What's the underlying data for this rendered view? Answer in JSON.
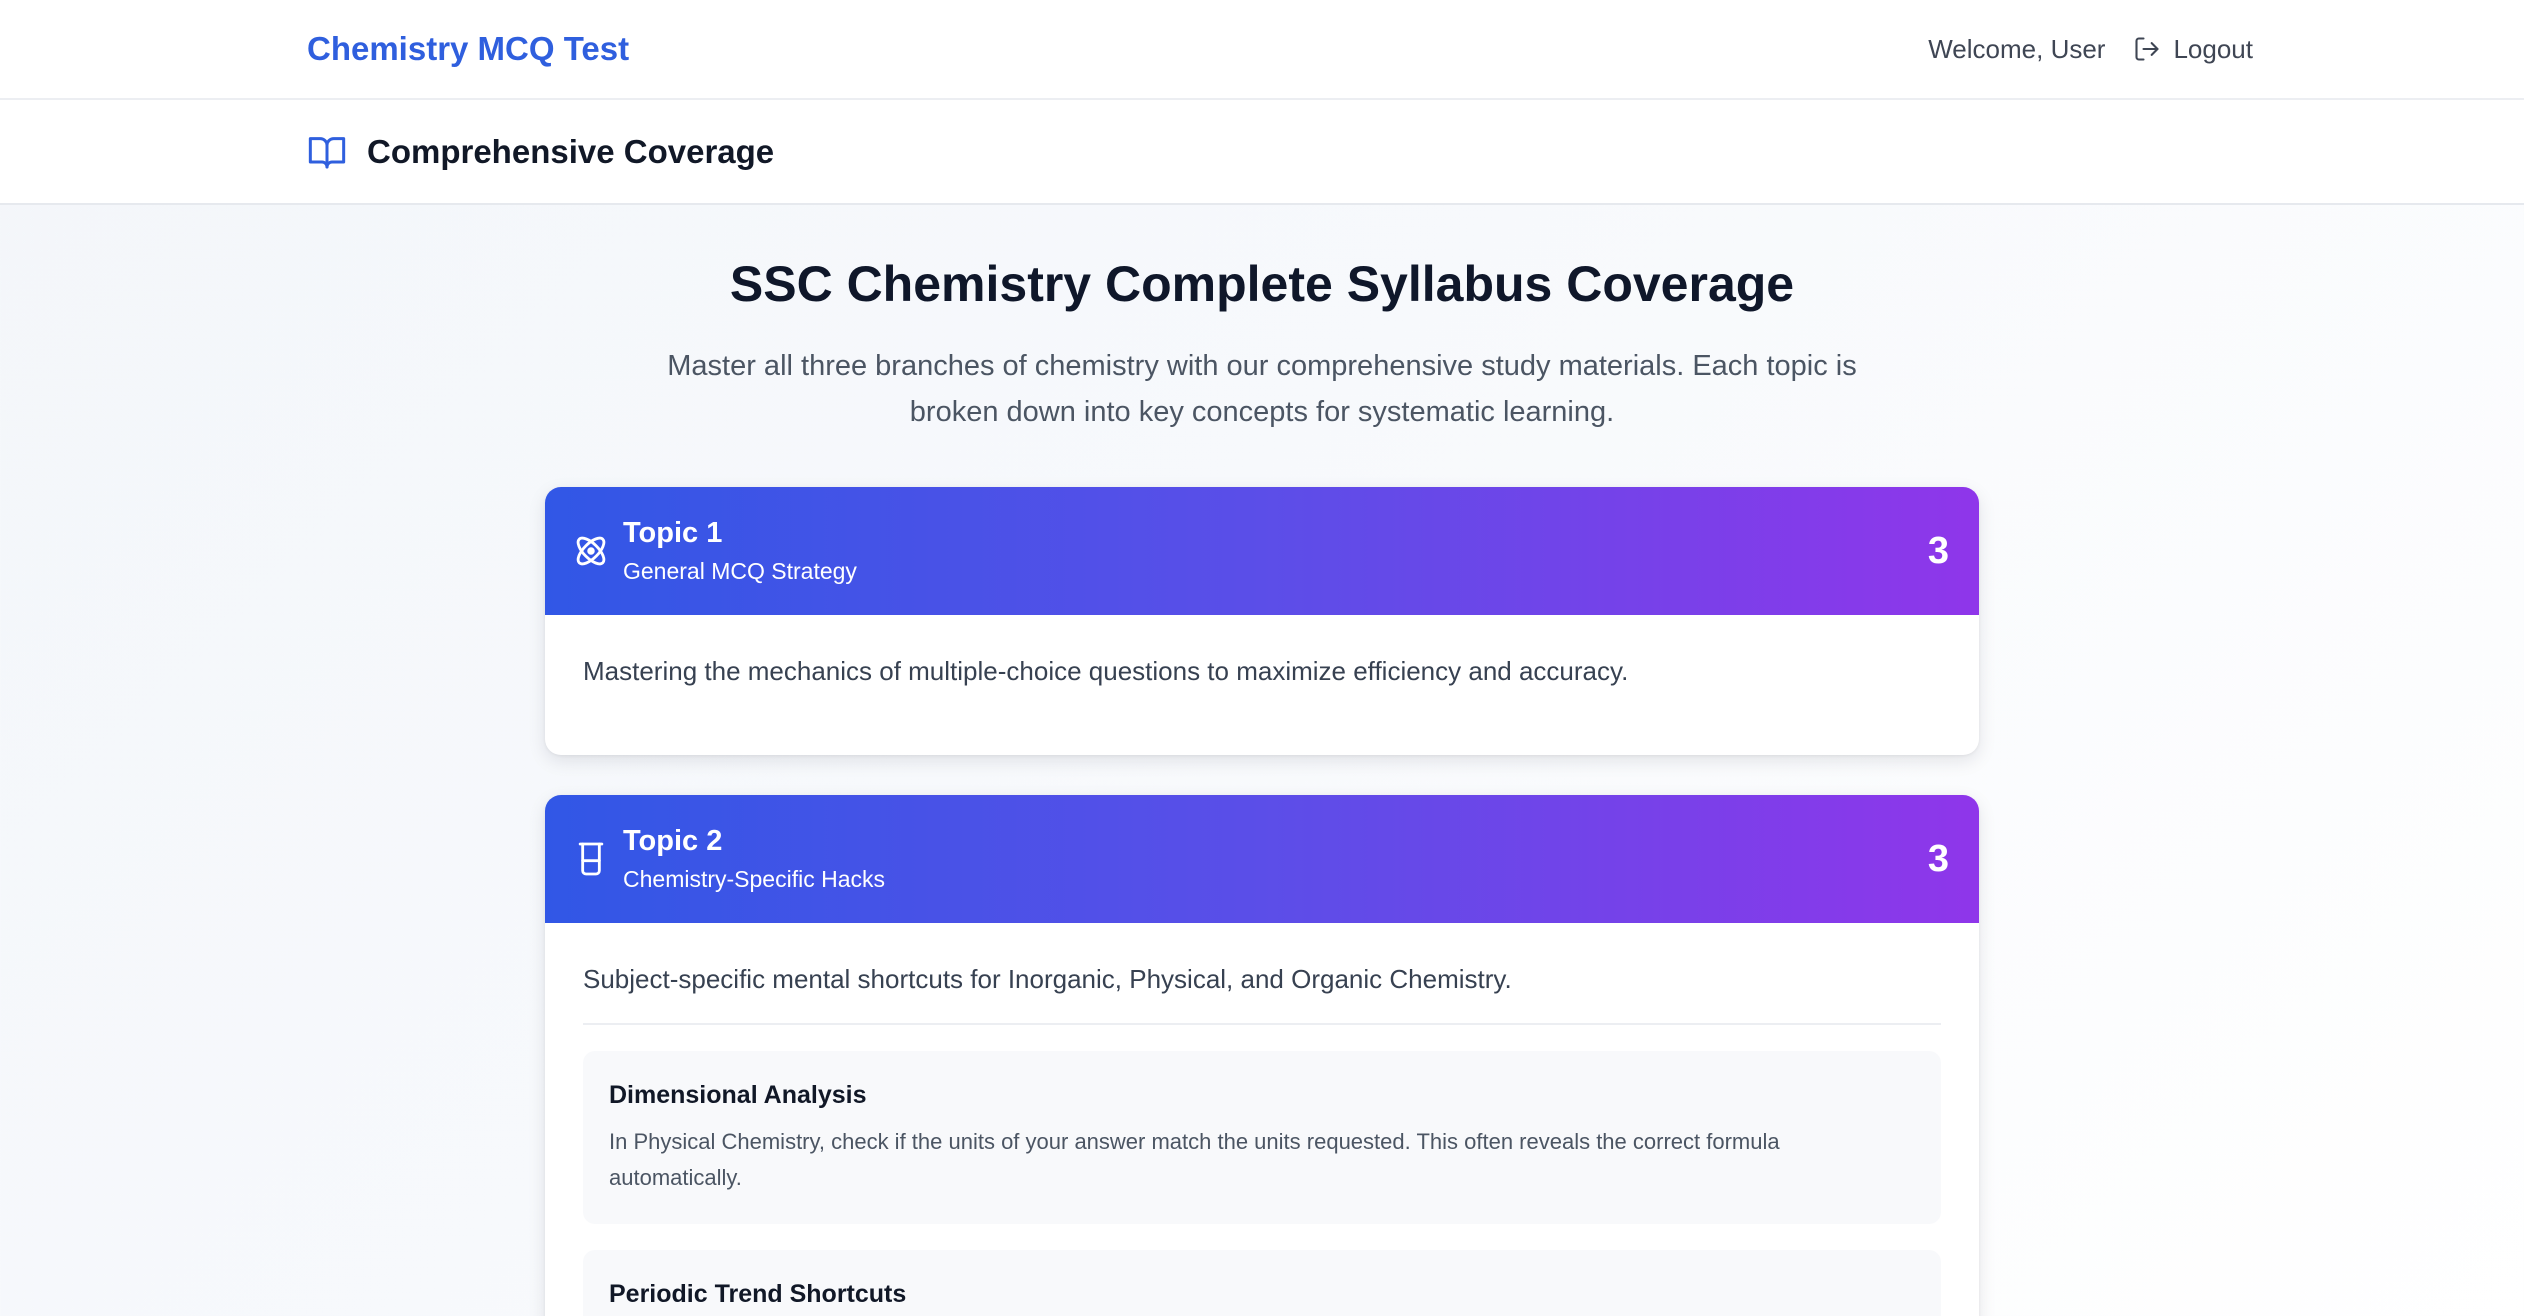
{
  "header": {
    "brand": "Chemistry MCQ Test",
    "welcome": "Welcome, User",
    "logout_label": "Logout"
  },
  "subheader": {
    "icon": "book-open-icon",
    "title": "Comprehensive Coverage"
  },
  "main": {
    "title": "SSC Chemistry Complete Syllabus Coverage",
    "description": "Master all three branches of chemistry with our comprehensive study materials. Each topic is broken down into key concepts for systematic learning."
  },
  "topics": [
    {
      "icon": "atom-icon",
      "title": "Topic 1",
      "subtitle": "General MCQ Strategy",
      "count": "3",
      "description": "Mastering the mechanics of multiple-choice questions to maximize efficiency and accuracy."
    },
    {
      "icon": "beaker-icon",
      "title": "Topic 2",
      "subtitle": "Chemistry-Specific Hacks",
      "count": "3",
      "description": "Subject-specific mental shortcuts for Inorganic, Physical, and Organic Chemistry.",
      "items": [
        {
          "title": "Dimensional Analysis",
          "text": "In Physical Chemistry, check if the units of your answer match the units requested. This often reveals the correct formula automatically."
        },
        {
          "title": "Periodic Trend Shortcuts",
          "text": ""
        }
      ]
    }
  ],
  "colors": {
    "brand": "#2f5fde",
    "gradient_start": "#3157e6",
    "gradient_end": "#8f36ea"
  }
}
